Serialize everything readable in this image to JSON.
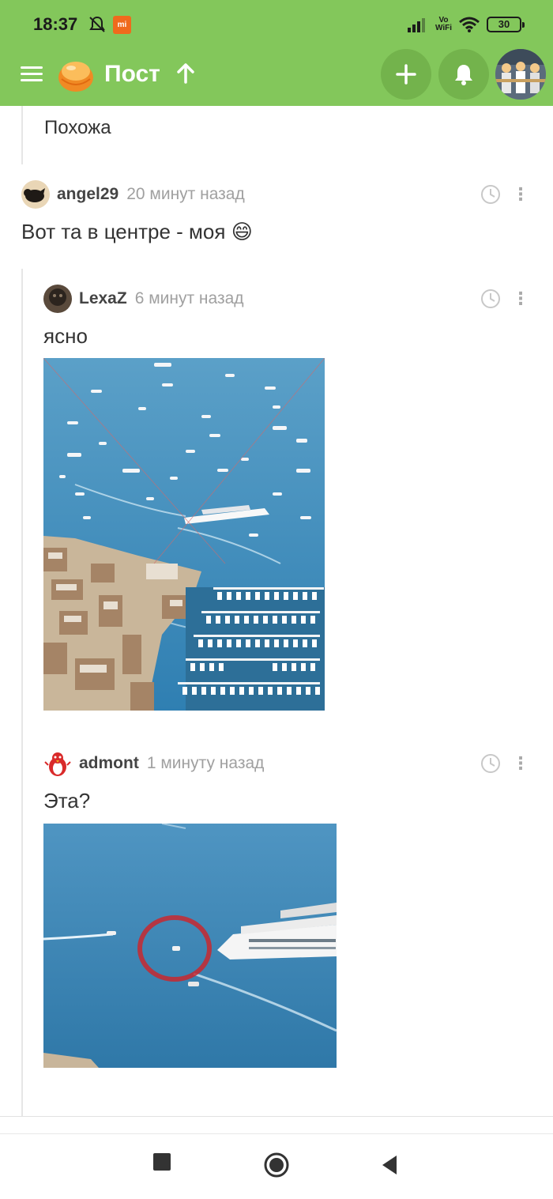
{
  "status": {
    "time": "18:37",
    "volte_top": "Vo",
    "volte_bottom": "WiFi",
    "battery": "30"
  },
  "appbar": {
    "title": "Пост",
    "colors": {
      "bar": "#83c75b",
      "button": "#73b34c"
    }
  },
  "thread": {
    "prev_reply": "Похожа",
    "comments": [
      {
        "author": "angel29",
        "time": "20 минут назад",
        "text": "Вот та в центре - моя 😄"
      },
      {
        "author": "LexaZ",
        "time": "6 минут назад",
        "text": "ясно"
      },
      {
        "author": "admont",
        "time": "1 минуту назад",
        "text": "Эта?"
      }
    ]
  },
  "icons": {
    "menu": "hamburger-icon",
    "logo": "pikabu-logo",
    "up": "arrow-up-icon",
    "add": "plus-icon",
    "bell": "bell-icon",
    "clock": "clock-icon",
    "more": "more-vertical-icon",
    "nav_recent": "square-icon",
    "nav_home": "circle-icon",
    "nav_back": "triangle-back-icon"
  }
}
